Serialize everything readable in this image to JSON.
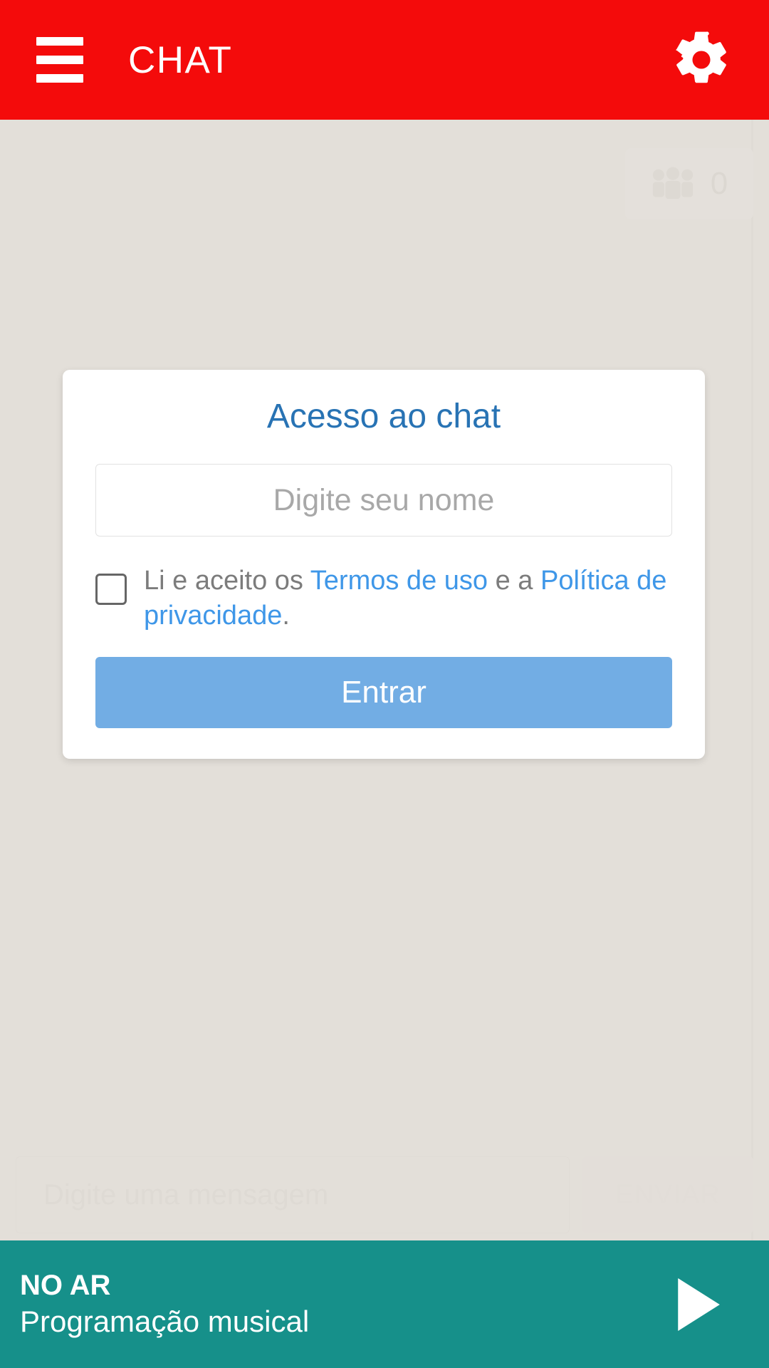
{
  "header": {
    "title": "CHAT",
    "menu_icon": "hamburger-menu-icon",
    "settings_icon": "gear-icon"
  },
  "chat": {
    "users_badge": {
      "icon": "people-group-icon",
      "count": "0"
    },
    "composer": {
      "placeholder": "Digite uma mensagem",
      "send_label": "ENVIAR"
    }
  },
  "modal": {
    "title": "Acesso ao chat",
    "name_input": {
      "placeholder": "Digite seu nome",
      "value": ""
    },
    "terms": {
      "prefix": "Li e aceito os ",
      "terms_link": "Termos de uso",
      "middle": " e a ",
      "privacy_link": "Política de privacidade",
      "suffix": ".",
      "checked": false
    },
    "submit_label": "Entrar"
  },
  "player": {
    "live_label": "NO AR",
    "program": "Programação musical",
    "play_icon": "play-triangle-icon"
  },
  "colors": {
    "header_red": "#f40b0b",
    "player_teal": "#16908a",
    "accent_blue": "#2873b4",
    "link_blue": "#3f97e8",
    "button_blue": "#72ade4",
    "page_background": "#e2ded8"
  }
}
